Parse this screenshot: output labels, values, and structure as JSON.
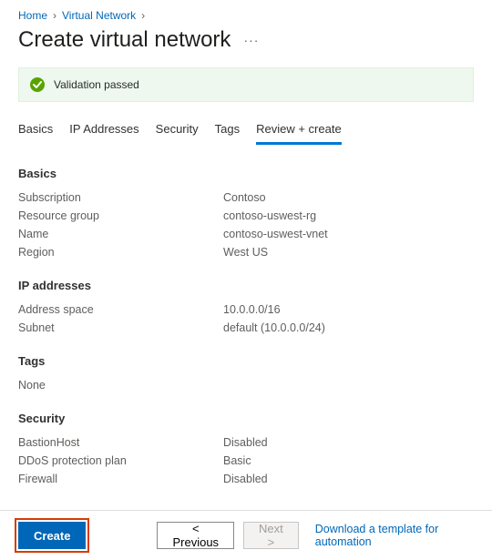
{
  "breadcrumb": {
    "items": [
      "Home",
      "Virtual Network"
    ]
  },
  "page_title": "Create virtual network",
  "banner": {
    "text": "Validation passed"
  },
  "tabs": {
    "items": [
      "Basics",
      "IP Addresses",
      "Security",
      "Tags",
      "Review + create"
    ],
    "active_index": 4
  },
  "sections": {
    "basics": {
      "title": "Basics",
      "rows": [
        {
          "key": "Subscription",
          "val": "Contoso"
        },
        {
          "key": "Resource group",
          "val": "contoso-uswest-rg"
        },
        {
          "key": "Name",
          "val": "contoso-uswest-vnet"
        },
        {
          "key": "Region",
          "val": "West US"
        }
      ]
    },
    "ip": {
      "title": "IP addresses",
      "rows": [
        {
          "key": "Address space",
          "val": "10.0.0.0/16"
        },
        {
          "key": "Subnet",
          "val": "default (10.0.0.0/24)"
        }
      ]
    },
    "tags_section": {
      "title": "Tags",
      "rows": [
        {
          "key": "None",
          "val": ""
        }
      ]
    },
    "security": {
      "title": "Security",
      "rows": [
        {
          "key": "BastionHost",
          "val": "Disabled"
        },
        {
          "key": "DDoS protection plan",
          "val": "Basic"
        },
        {
          "key": "Firewall",
          "val": "Disabled"
        }
      ]
    }
  },
  "footer": {
    "create": "Create",
    "previous": "<  Previous",
    "next": "Next  >",
    "download_link": "Download a template for automation"
  }
}
